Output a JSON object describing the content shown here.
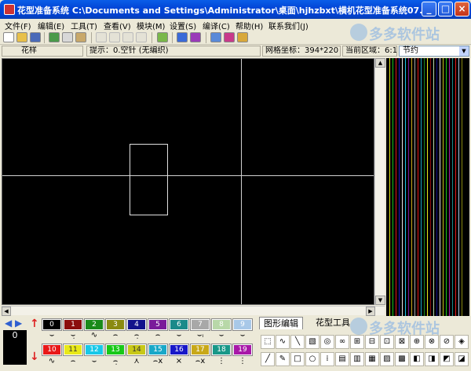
{
  "window": {
    "title": "花型准备系统 C:\\Documents and Settings\\Administrator\\桌面\\hjhzbxt\\横机花型准备系统07...",
    "min": "_",
    "max": "□",
    "close": "×"
  },
  "menu": [
    "文件(F)",
    "编辑(E)",
    "工具(T)",
    "查看(V)",
    "模块(M)",
    "设置(S)",
    "编译(C)",
    "帮助(H)",
    "联系我们(J)"
  ],
  "status": {
    "pattern_label": "花样",
    "hint": "提示：0.空针 (无编织)",
    "grid_coord": "网格坐标：394*220",
    "current_area": "当前区域：6:1",
    "combo_value": "节约"
  },
  "canvas_index": "0",
  "palette": {
    "row1": [
      {
        "n": "0",
        "c": "#000000"
      },
      {
        "n": "1",
        "c": "#8b0d0d"
      },
      {
        "n": "2",
        "c": "#1a8a1a"
      },
      {
        "n": "3",
        "c": "#8a8a10"
      },
      {
        "n": "4",
        "c": "#12128c"
      },
      {
        "n": "5",
        "c": "#7a1a9a"
      },
      {
        "n": "6",
        "c": "#1a8a8a"
      },
      {
        "n": "7",
        "c": "#a8a8a8"
      },
      {
        "n": "8",
        "c": "#b8d8a8"
      },
      {
        "n": "9",
        "c": "#a8c8e8"
      }
    ],
    "row2": [
      {
        "n": "10",
        "c": "#e81818"
      },
      {
        "n": "11",
        "c": "#e8e818"
      },
      {
        "n": "12",
        "c": "#18c8e8"
      },
      {
        "n": "13",
        "c": "#18c818"
      },
      {
        "n": "14",
        "c": "#c8c818"
      },
      {
        "n": "15",
        "c": "#18a8c8"
      },
      {
        "n": "16",
        "c": "#1818c8"
      },
      {
        "n": "17",
        "c": "#c8a818"
      },
      {
        "n": "18",
        "c": "#189888"
      },
      {
        "n": "19",
        "c": "#a818a8"
      }
    ],
    "stitch1": [
      "⌣",
      "⌣̣",
      "∿",
      "⌢",
      "⌢̣",
      "⌢",
      "⌣",
      "⌣ᵢ",
      "⌣",
      "⌣"
    ],
    "stitch2": [
      "∿",
      "⌢",
      "⌣",
      "⌢̣",
      "⋏",
      "⌢x",
      "×",
      "⌢x",
      "⋮",
      "⋮"
    ]
  },
  "tabs": {
    "graphic": "图形编辑",
    "pattern": "花型工具"
  },
  "watermark": "多多软件站",
  "colors": {
    "title_bar": "#0347d8",
    "canvas": "#000000",
    "grid_line": "#d0d0d0"
  }
}
